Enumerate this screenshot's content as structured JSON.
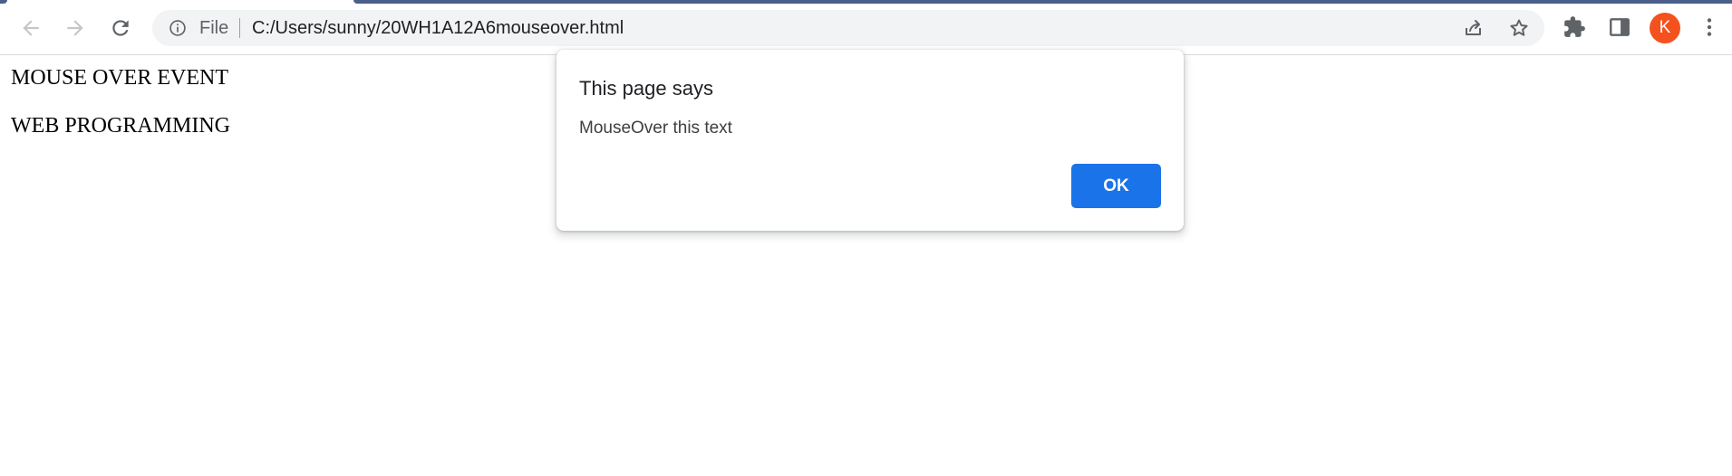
{
  "browser": {
    "address_bar": {
      "scheme_label": "File",
      "url": "C:/Users/sunny/20WH1A12A6mouseover.html"
    },
    "profile_initial": "K",
    "colors": {
      "accent": "#4a5f8a",
      "avatar": "#f4511e",
      "omnibox_bg": "#f1f3f4"
    },
    "icons": {
      "back": "arrow-left-icon",
      "forward": "arrow-right-icon",
      "reload": "reload-icon",
      "site_info": "info-icon",
      "share": "share-icon",
      "bookmark": "star-icon",
      "extensions": "puzzle-icon",
      "side_panel": "side-panel-icon",
      "menu": "kebab-menu-icon"
    }
  },
  "page": {
    "lines": [
      "MOUSE OVER EVENT",
      "WEB PROGRAMMING"
    ]
  },
  "dialog": {
    "title": "This page says",
    "message": "MouseOver this text",
    "ok_label": "OK",
    "ok_color": "#1a73e8"
  }
}
